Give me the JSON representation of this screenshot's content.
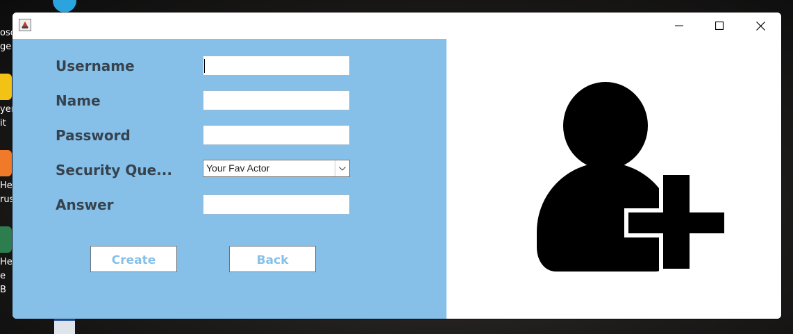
{
  "desktop": {
    "fragments": [
      "osc",
      "ge",
      "yer",
      "it",
      "He",
      "rus",
      "He",
      "e B"
    ]
  },
  "window": {
    "app_icon": "java-app-icon",
    "controls": {
      "minimize": "minimize-icon",
      "maximize": "maximize-icon",
      "close": "close-icon"
    }
  },
  "form": {
    "username_label": "Username",
    "name_label": "Name",
    "password_label": "Password",
    "security_label": "Security Que...",
    "answer_label": "Answer",
    "username_value": "",
    "name_value": "",
    "password_value": "",
    "security_selected": "Your Fav Actor",
    "answer_value": "",
    "create_label": "Create",
    "back_label": "Back"
  },
  "illustration": {
    "icon": "add-user-icon"
  },
  "colors": {
    "panel": "#86c0e9",
    "label": "#36424d",
    "button_text": "#86c0e9"
  }
}
